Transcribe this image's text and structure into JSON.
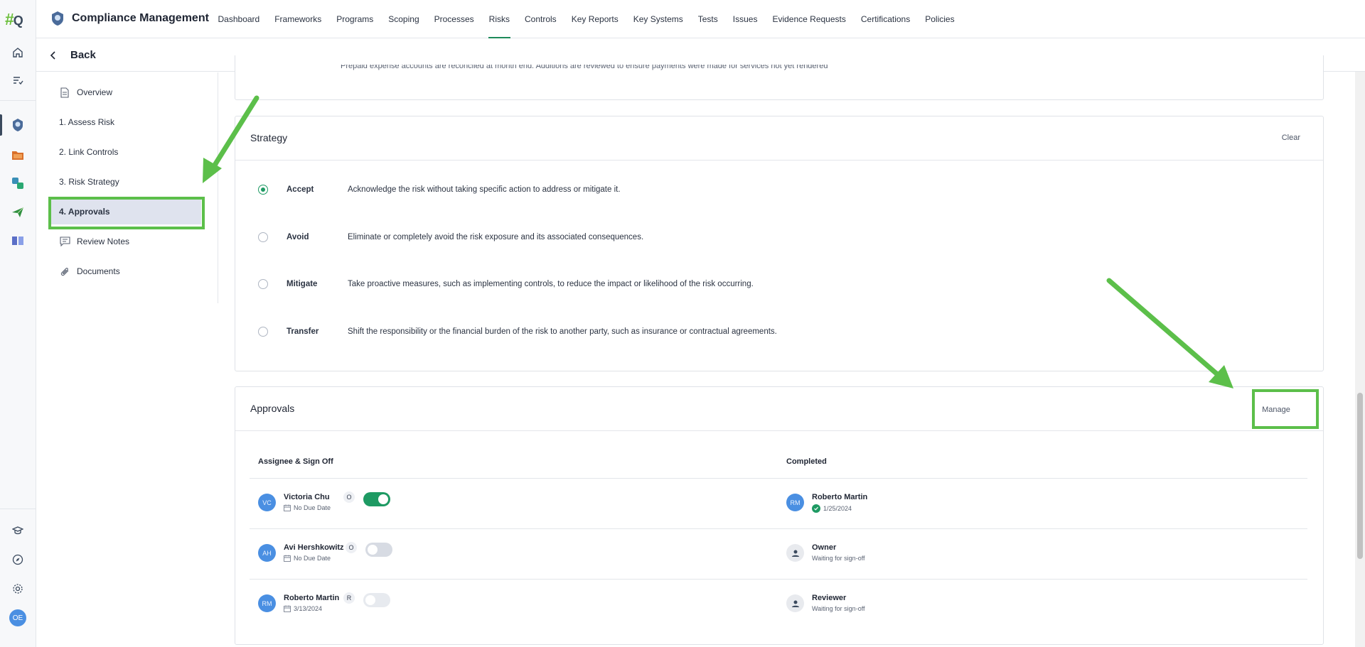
{
  "app": {
    "logo_hash": "#",
    "logo_q": "Q",
    "title": "Compliance Management",
    "user_initials": "OE"
  },
  "nav": {
    "items": [
      "Dashboard",
      "Frameworks",
      "Programs",
      "Scoping",
      "Processes",
      "Risks",
      "Controls",
      "Key Reports",
      "Key Systems",
      "Tests",
      "Issues",
      "Evidence Requests",
      "Certifications",
      "Policies"
    ],
    "active": "Risks"
  },
  "back": {
    "label": "Back"
  },
  "sidemenu": {
    "overview": "Overview",
    "assess": "1. Assess Risk",
    "link": "2. Link Controls",
    "strategy": "3. Risk Strategy",
    "approvals": "4. Approvals",
    "review": "Review Notes",
    "documents": "Documents"
  },
  "top_card": {
    "truncated_text": "Prepaid expense accounts are reconciled at month end. Additions are reviewed to ensure payments were made for services not yet rendered"
  },
  "strategy": {
    "title": "Strategy",
    "clear_label": "Clear",
    "selected": "Accept",
    "options": [
      {
        "label": "Accept",
        "desc": "Acknowledge the risk without taking specific action to address or mitigate it."
      },
      {
        "label": "Avoid",
        "desc": "Eliminate or completely avoid the risk exposure and its associated consequences."
      },
      {
        "label": "Mitigate",
        "desc": "Take proactive measures, such as implementing controls, to reduce the impact or likelihood of the risk occurring."
      },
      {
        "label": "Transfer",
        "desc": "Shift the responsibility or the financial burden of the risk to another party, such as insurance or contractual agreements."
      }
    ]
  },
  "approvals": {
    "title": "Approvals",
    "manage_label": "Manage",
    "col_assignee": "Assignee & Sign Off",
    "col_completed": "Completed",
    "rows": [
      {
        "initials": "VC",
        "name": "Victoria Chu",
        "role": "O",
        "due": "No Due Date",
        "toggle": "on",
        "completed_initials": "RM",
        "completed_name": "Roberto Martin",
        "completed_sub": "1/25/2024"
      },
      {
        "initials": "AH",
        "name": "Avi Hershkowitz",
        "role": "O",
        "due": "No Due Date",
        "toggle": "off",
        "completed_initials": "",
        "completed_name": "Owner",
        "completed_sub": "Waiting for sign-off"
      },
      {
        "initials": "RM",
        "name": "Roberto Martin",
        "role": "R",
        "due": "3/13/2024",
        "toggle": "disabled",
        "completed_initials": "",
        "completed_name": "Reviewer",
        "completed_sub": "Waiting for sign-off"
      }
    ]
  },
  "colors": {
    "accent_green": "#1e9a63",
    "highlight_green": "#5cbf4a",
    "avatar_blue": "#4a8fe2"
  }
}
